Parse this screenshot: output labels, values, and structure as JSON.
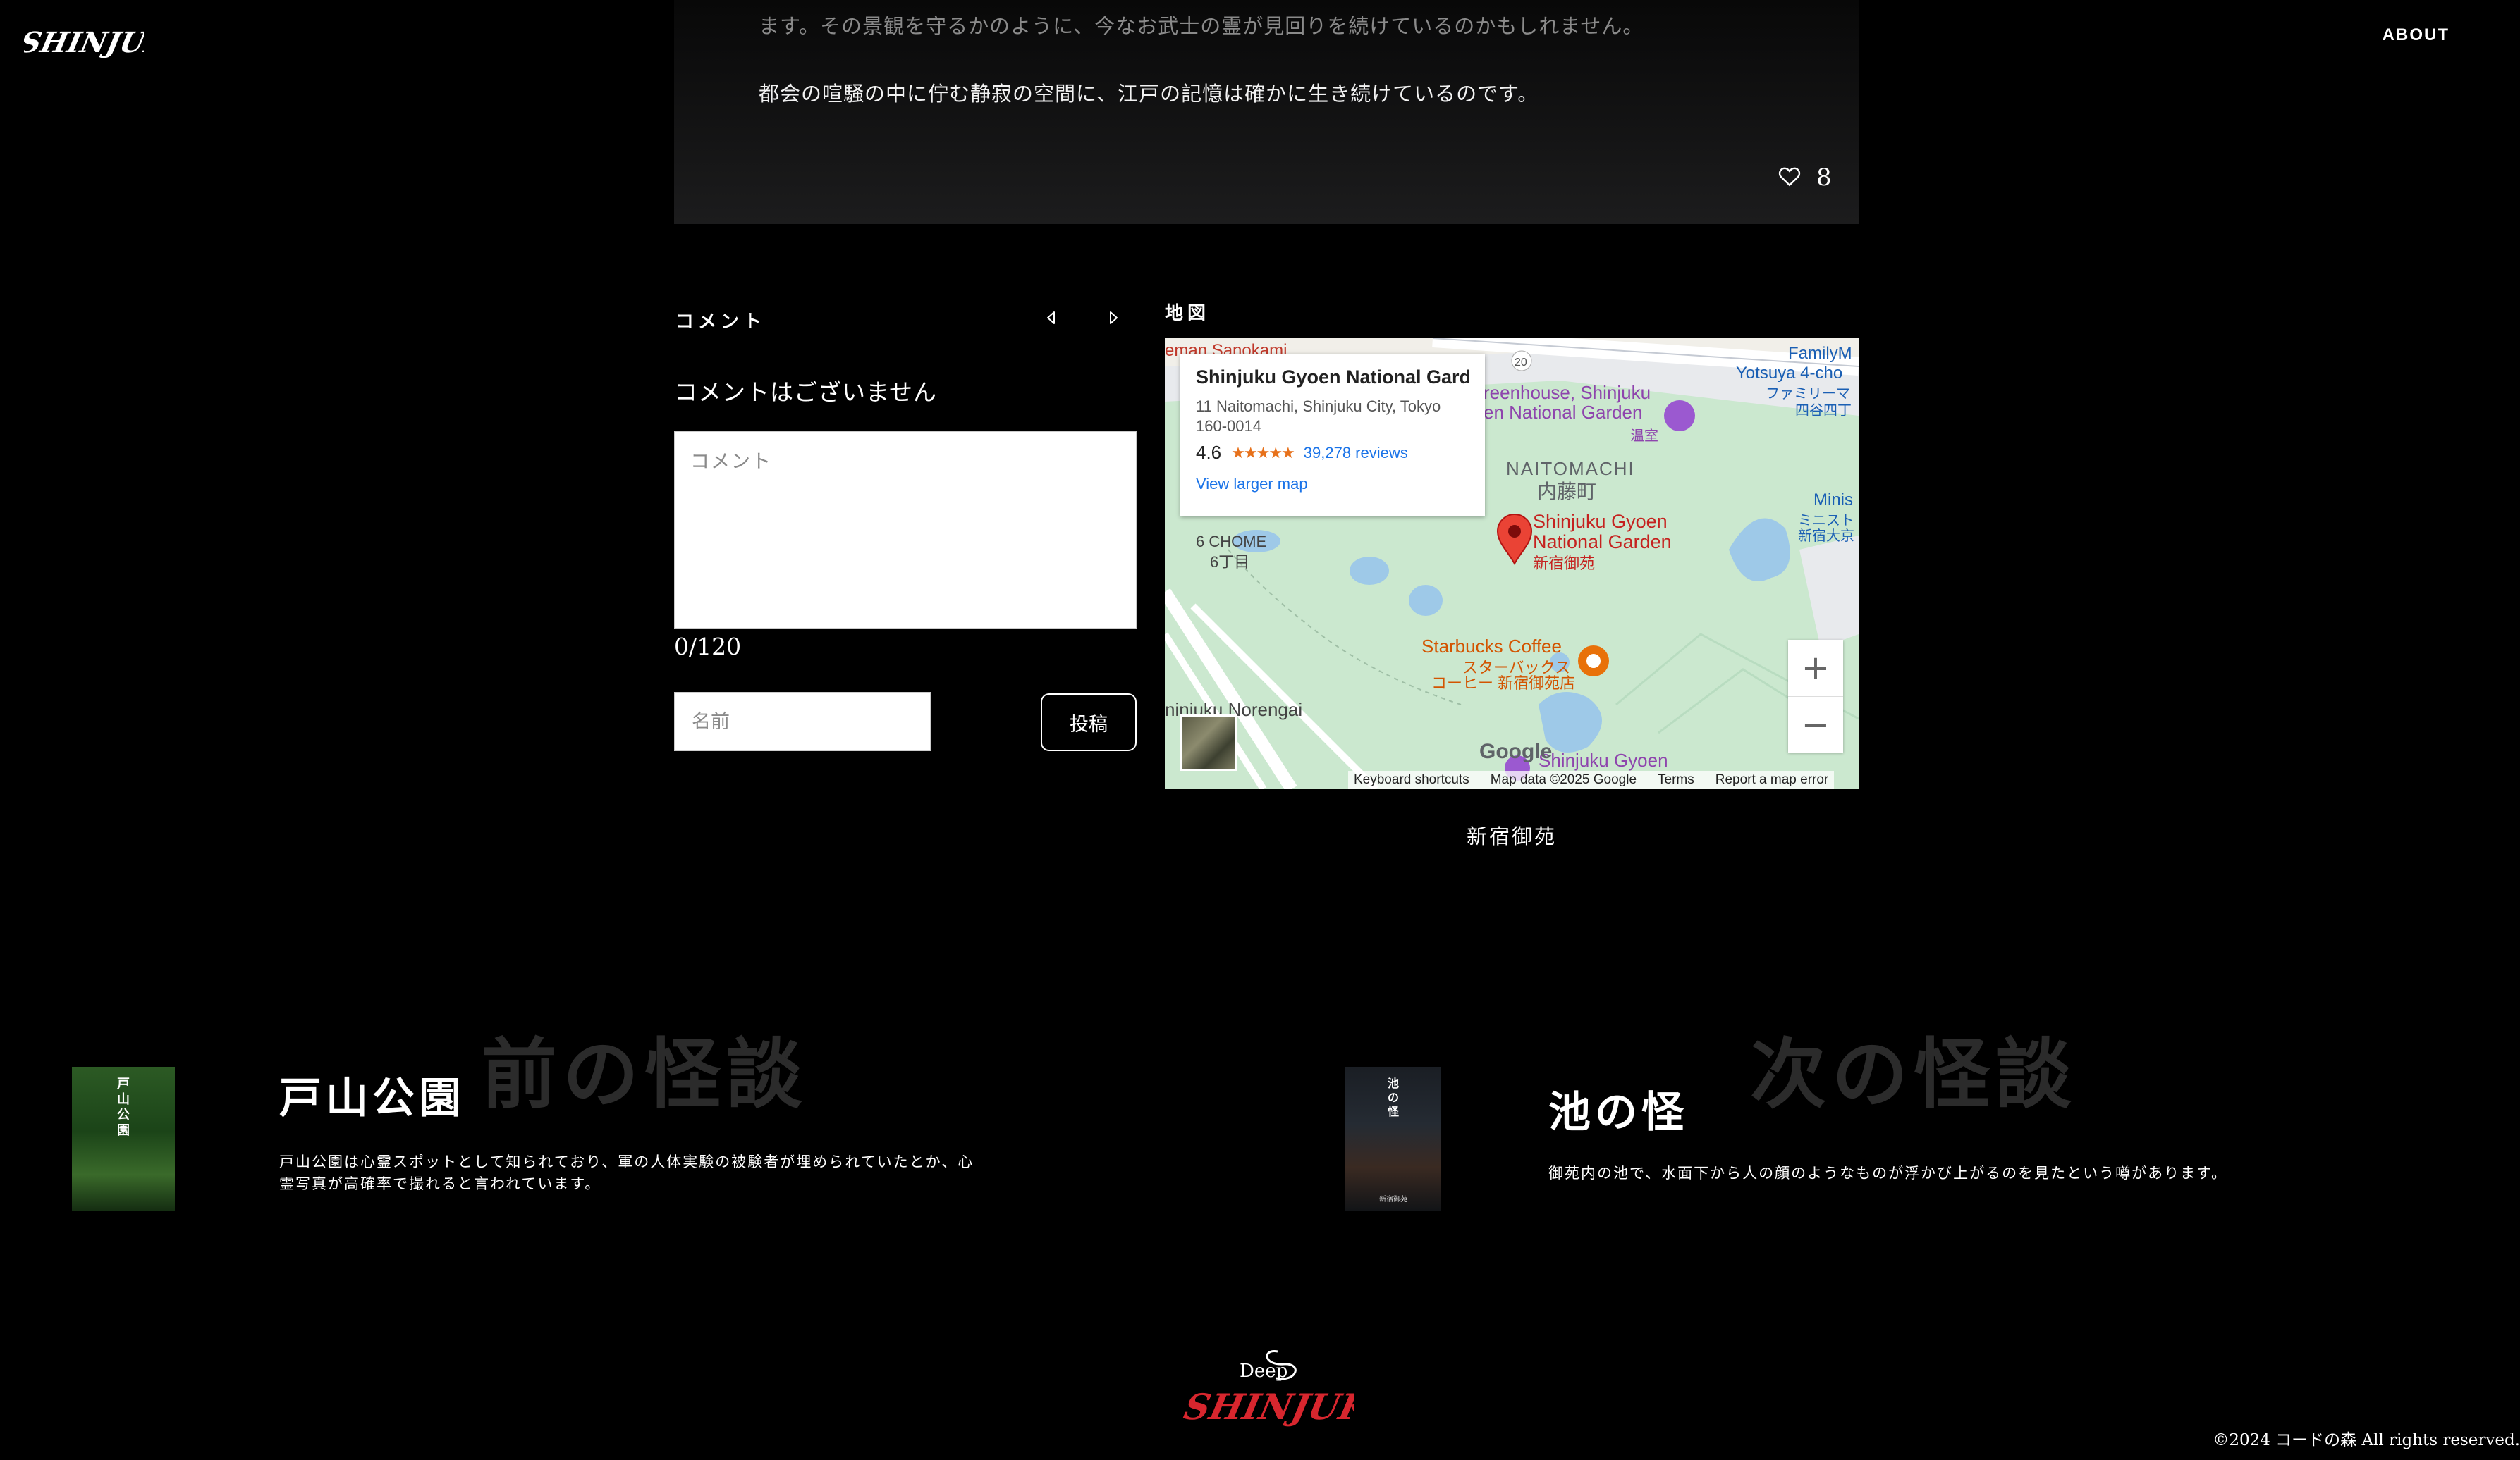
{
  "header": {
    "logo_text": "SHINJUKU",
    "nav_about": "ABOUT"
  },
  "article": {
    "paragraph_tail": "ます。その景観を守るかのように、今なお武士の霊が見回りを続けているのかもしれません。",
    "paragraph_last": "都会の喧騒の中に佇む静寂の空間に、江戸の記憶は確かに生き続けているのです。",
    "like_count": "8"
  },
  "comments": {
    "section_label": "コメント",
    "empty_message": "コメントはございません",
    "textarea_placeholder": "コメント",
    "char_counter": "0/120",
    "name_placeholder": "名前",
    "submit_label": "投稿"
  },
  "map": {
    "section_label": "地図",
    "place_title": "Shinjuku Gyoen National Gard...",
    "address": "11 Naitomachi, Shinjuku City, Tokyo 160-0014",
    "rating": "4.6",
    "reviews": "39,278 reviews",
    "view_larger": "View larger map",
    "labels": {
      "naitomachi_en": "NAITOMACHI",
      "naitomachi_ja": "内藤町",
      "marker_en_1": "Shinjuku Gyoen",
      "marker_en_2": "National Garden",
      "marker_ja": "新宿御苑",
      "chome_en": "6 CHOME",
      "chome_ja": "6丁目",
      "starbucks_en": "Starbucks Coffee",
      "starbucks_ja_1": "スターバックス",
      "starbucks_ja_2": "コーヒー 新宿御苑店",
      "greenhouse_1": "reenhouse, Shinjuku",
      "greenhouse_2": "en National Garden",
      "greenhouse_ja": "温室",
      "yotsuya_1": "FamilyM",
      "yotsuya_2": "Yotsuya 4-cho",
      "yotsuya_3": "ファミリーマ",
      "yotsuya_4": "四谷四丁",
      "minis_1": "Minis",
      "minis_2": "ミニスト",
      "minis_3": "新宿大京",
      "norengai": "ninjuku Norengai",
      "bottom_label": "Shinjuku Gyoen",
      "top_left": "eman Sanokami",
      "route": "20"
    },
    "google": "Google",
    "attribution": {
      "keyboard": "Keyboard shortcuts",
      "map_data": "Map data ©2025 Google",
      "terms": "Terms",
      "report": "Report a map error"
    },
    "caption": "新宿御苑"
  },
  "prev": {
    "watermark": "前の怪談",
    "title": "戸山公園",
    "thumb_text": "戸\n山\n公\n園",
    "description": "戸山公園は心霊スポットとして知られており、軍の人体実験の被験者が埋められていたとか、心霊写真が高確率で撮れると言われています。"
  },
  "next": {
    "watermark": "次の怪談",
    "title": "池の怪",
    "thumb_text": "池\nの\n怪",
    "thumb_footer": "新宿御苑",
    "description": "御苑内の池で、水面下から人の顔のようなものが浮かび上がるのを見たという噂があります。"
  },
  "footer": {
    "logo_small": "Deep",
    "logo_text": "SHINJUKU",
    "copyright": "©2024 コードの森 All rights reserved."
  },
  "colors": {
    "logo_red": "#d8262e",
    "map_park": "#cbe8cf",
    "map_water": "#9ec9e8",
    "marker_red": "#ea4335",
    "link_blue": "#1a73e8",
    "starbucks_orange": "#e8710a"
  },
  "icons": {
    "like": "heart-outline-icon",
    "prev_arrow": "caret-left-icon",
    "next_arrow": "caret-right-icon",
    "marker": "map-pin-icon",
    "zoom_in": "plus-icon",
    "zoom_out": "minus-icon"
  }
}
